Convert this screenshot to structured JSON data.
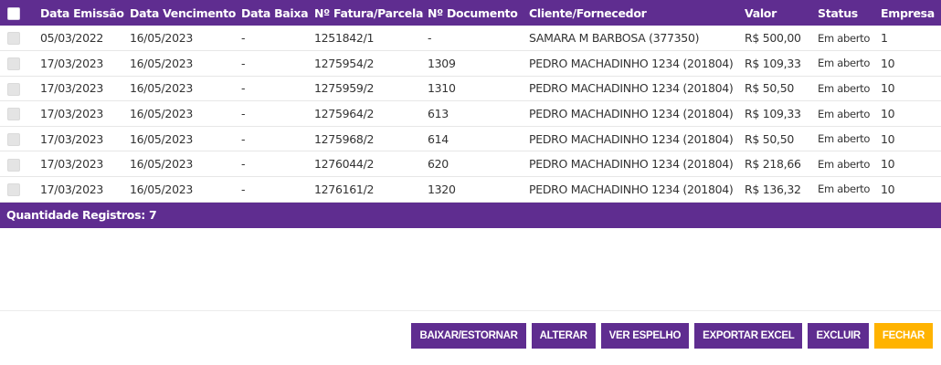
{
  "table": {
    "headers": {
      "data_emissao": "Data Emissão",
      "data_vencimento": "Data Vencimento",
      "data_baixa": "Data Baixa",
      "fatura_parcela": "Nº Fatura/Parcela",
      "documento": "Nº Documento",
      "cliente_fornecedor": "Cliente/Fornecedor",
      "valor": "Valor",
      "status": "Status",
      "empresa": "Empresa"
    },
    "rows": [
      {
        "emissao": "05/03/2022",
        "vencimento": "16/05/2023",
        "baixa": "-",
        "fatura": "1251842/1",
        "documento": "-",
        "cliente": "SAMARA M BARBOSA (377350)",
        "valor": "R$ 500,00",
        "status": "Em aberto",
        "empresa": "1"
      },
      {
        "emissao": "17/03/2023",
        "vencimento": "16/05/2023",
        "baixa": "-",
        "fatura": "1275954/2",
        "documento": "1309",
        "cliente": "PEDRO MACHADINHO 1234 (201804)",
        "valor": "R$ 109,33",
        "status": "Em aberto",
        "empresa": "10"
      },
      {
        "emissao": "17/03/2023",
        "vencimento": "16/05/2023",
        "baixa": "-",
        "fatura": "1275959/2",
        "documento": "1310",
        "cliente": "PEDRO MACHADINHO 1234 (201804)",
        "valor": "R$ 50,50",
        "status": "Em aberto",
        "empresa": "10"
      },
      {
        "emissao": "17/03/2023",
        "vencimento": "16/05/2023",
        "baixa": "-",
        "fatura": "1275964/2",
        "documento": "613",
        "cliente": "PEDRO MACHADINHO 1234 (201804)",
        "valor": "R$ 109,33",
        "status": "Em aberto",
        "empresa": "10"
      },
      {
        "emissao": "17/03/2023",
        "vencimento": "16/05/2023",
        "baixa": "-",
        "fatura": "1275968/2",
        "documento": "614",
        "cliente": "PEDRO MACHADINHO 1234 (201804)",
        "valor": "R$ 50,50",
        "status": "Em aberto",
        "empresa": "10"
      },
      {
        "emissao": "17/03/2023",
        "vencimento": "16/05/2023",
        "baixa": "-",
        "fatura": "1276044/2",
        "documento": "620",
        "cliente": "PEDRO MACHADINHO 1234 (201804)",
        "valor": "R$ 218,66",
        "status": "Em aberto",
        "empresa": "10"
      },
      {
        "emissao": "17/03/2023",
        "vencimento": "16/05/2023",
        "baixa": "-",
        "fatura": "1276161/2",
        "documento": "1320",
        "cliente": "PEDRO MACHADINHO 1234 (201804)",
        "valor": "R$ 136,32",
        "status": "Em aberto",
        "empresa": "10"
      }
    ]
  },
  "footer": {
    "count_label": "Quantidade Registros: 7"
  },
  "actions": {
    "baixar_estornar": "BAIXAR/ESTORNAR",
    "alterar": "ALTERAR",
    "ver_espelho": "VER ESPELHO",
    "exportar_excel": "EXPORTAR EXCEL",
    "excluir": "EXCLUIR",
    "fechar": "FECHAR"
  },
  "colors": {
    "primary": "#5f2d90",
    "accent": "#ffb300"
  }
}
